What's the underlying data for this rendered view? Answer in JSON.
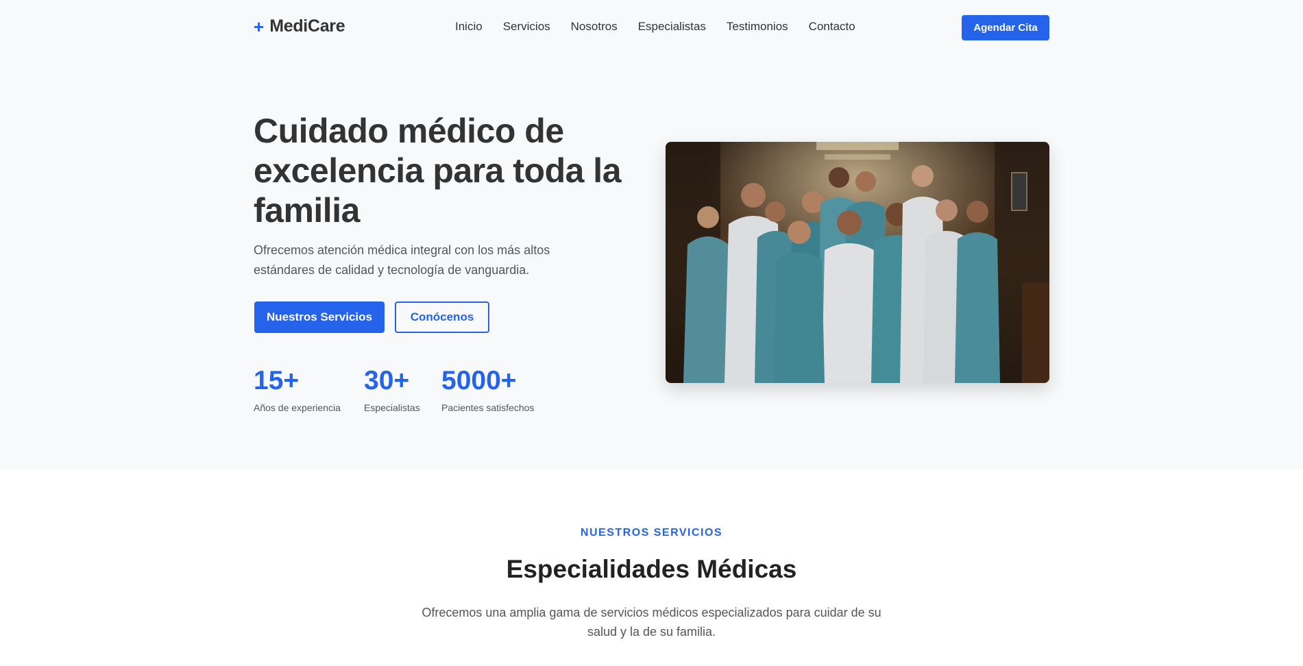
{
  "brand": {
    "icon": "plus-icon",
    "icon_glyph": "+",
    "name": "MediCare",
    "accent": "#2563eb"
  },
  "nav": {
    "items": [
      {
        "label": "Inicio"
      },
      {
        "label": "Servicios"
      },
      {
        "label": "Nosotros"
      },
      {
        "label": "Especialistas"
      },
      {
        "label": "Testimonios"
      },
      {
        "label": "Contacto"
      }
    ],
    "cta_label": "Agendar Cita"
  },
  "hero": {
    "title": "Cuidado médico de excelencia para toda la familia",
    "description": "Ofrecemos atención médica integral con los más altos estándares de calidad y tecnología de vanguardia.",
    "primary_button": "Nuestros Servicios",
    "secondary_button": "Conócenos",
    "stats": [
      {
        "value": "15+",
        "label": "Años de experiencia"
      },
      {
        "value": "30+",
        "label": "Especialistas"
      },
      {
        "value": "5000+",
        "label": "Pacientes satisfechos"
      }
    ]
  },
  "services": {
    "eyebrow": "NUESTROS SERVICIOS",
    "title": "Especialidades Médicas",
    "description": "Ofrecemos una amplia gama de servicios médicos especializados para cuidar de su salud y la de su familia."
  }
}
